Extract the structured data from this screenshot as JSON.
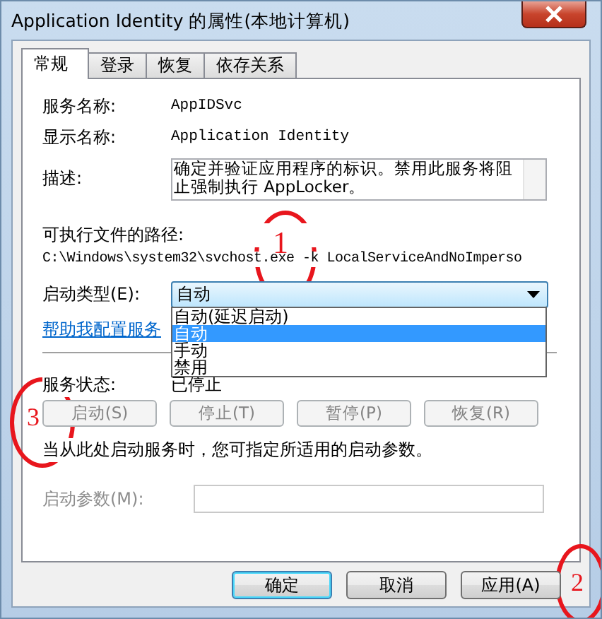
{
  "window": {
    "title": "Application Identity 的属性(本地计算机)"
  },
  "tabs": [
    {
      "label": "常规",
      "selected": true
    },
    {
      "label": "登录",
      "selected": false
    },
    {
      "label": "恢复",
      "selected": false
    },
    {
      "label": "依存关系",
      "selected": false
    }
  ],
  "fields": [
    {
      "label": "服务名称:",
      "value": "AppIDSvc"
    },
    {
      "label": "显示名称:",
      "value": "Application Identity"
    }
  ],
  "description": {
    "label": "描述:",
    "value": "确定并验证应用程序的标识。禁用此服务将阻止强制执行 AppLocker。"
  },
  "path": {
    "label": "可执行文件的路径:",
    "value": "C:\\Windows\\system32\\svchost.exe -k LocalServiceAndNoImperso"
  },
  "startup_type": {
    "label": "启动类型(E):",
    "value": "自动",
    "expanded": true,
    "options": [
      {
        "label": "自动(延迟启动)",
        "selected": false
      },
      {
        "label": "自动",
        "selected": true
      },
      {
        "label": "手动",
        "selected": false
      },
      {
        "label": "禁用",
        "selected": false
      }
    ]
  },
  "help_link": "帮助我配置服务",
  "service_status": {
    "label": "服务状态:",
    "value": "已停止"
  },
  "service_buttons": [
    {
      "label": "启动(S)",
      "disabled": true
    },
    {
      "label": "停止(T)",
      "disabled": true
    },
    {
      "label": "暂停(P)",
      "disabled": true
    },
    {
      "label": "恢复(R)",
      "disabled": true
    }
  ],
  "note": "当从此处启动服务时，您可指定所适用的启动参数。",
  "start_parameters": {
    "label": "启动参数(M):",
    "disabled": true
  },
  "dialog_buttons": [
    {
      "label": "确定",
      "default": true
    },
    {
      "label": "取消",
      "default": false
    },
    {
      "label": "应用(A)",
      "default": false
    }
  ],
  "annotations": [
    {
      "label": "1"
    },
    {
      "label": "3"
    },
    {
      "label": "2"
    }
  ]
}
